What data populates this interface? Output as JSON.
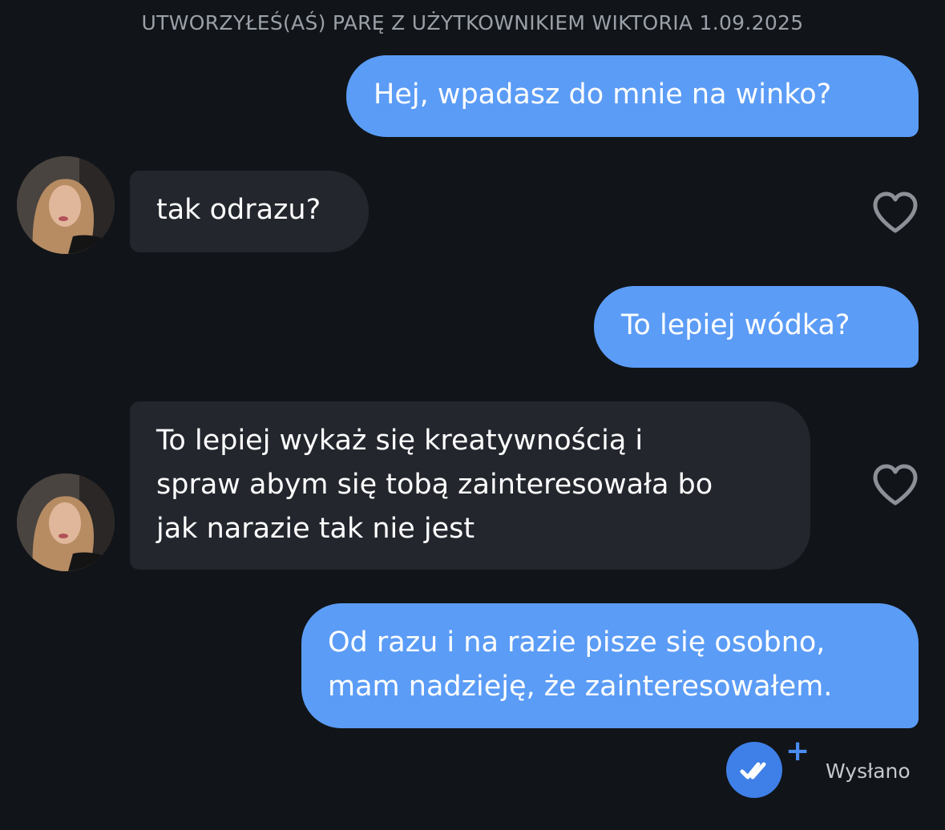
{
  "header": {
    "match_notice": "UTWORZYŁEŚ(AŚ) PARĘ Z UŻYTKOWNIKIEM WIKTORIA 1.09.2025"
  },
  "messages": [
    {
      "direction": "sent",
      "lines": [
        "Hej, wpadasz do mnie na winko?"
      ]
    },
    {
      "direction": "received",
      "lines": [
        "tak odrazu?"
      ],
      "liked": false
    },
    {
      "direction": "sent",
      "lines": [
        "To lepiej wódka?"
      ]
    },
    {
      "direction": "received",
      "lines": [
        "To lepiej wykaż się kreatywnością i",
        "spraw abym się tobą zainteresowała bo",
        "jak narazie tak nie jest"
      ],
      "liked": false
    },
    {
      "direction": "sent",
      "lines": [
        "Od razu i na razie pisze się osobno,",
        "mam nadzieję, że zainteresowałem."
      ]
    }
  ],
  "status": {
    "delivery_label": "Wysłano",
    "plus_symbol": "+",
    "icon": "double-check-icon"
  },
  "colors": {
    "background": "#111418",
    "sent_bubble": "#5b9cf6",
    "received_bubble": "#23262d",
    "header_text": "#9aa0a8",
    "accent": "#3f7fe8"
  }
}
